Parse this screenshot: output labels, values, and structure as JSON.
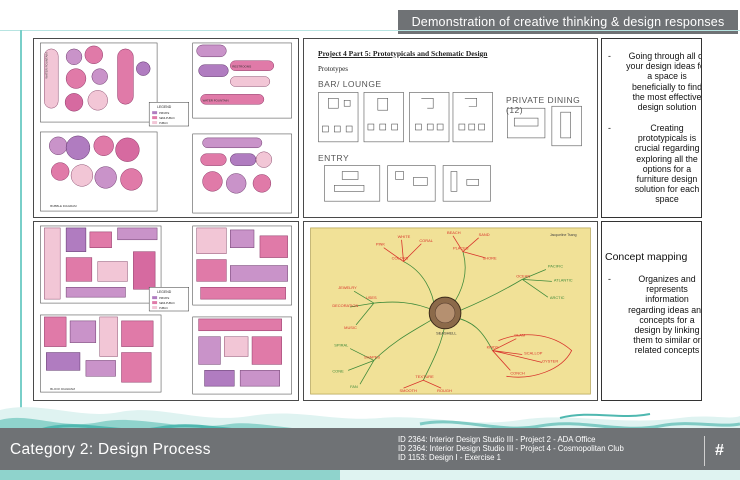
{
  "header": {
    "banner": "Demonstration of creative thinking & design responses"
  },
  "panels": {
    "bubble_top": {
      "bubbles": [
        {
          "label": "PRIVATE DINING"
        },
        {
          "label": "RESTROOMS"
        },
        {
          "label": "LOUNGE"
        },
        {
          "label": "BAR"
        },
        {
          "label": "ENTRY"
        },
        {
          "label": "GAMING"
        }
      ],
      "bubbles_right": [
        {
          "label": "ENTRY"
        },
        {
          "label": "LOUNGE"
        },
        {
          "label": "RESTROOMS"
        },
        {
          "label": "WATER FOUNTAIN"
        },
        {
          "label": "BAR"
        },
        {
          "label": "GAMING"
        }
      ],
      "legend": {
        "title": "LEGEND",
        "items": [
          "PRIVATE",
          "SEMI-PUBLIC",
          "PUBLIC"
        ]
      },
      "caption": "BUBBLE DIAGRAM",
      "caption_sub": "SCALE: NTS"
    },
    "bubble_bottom": {
      "legend": {
        "title": "LEGEND",
        "items": [
          "PRIVATE",
          "SEMI-PUBLIC",
          "PUBLIC"
        ]
      },
      "caption": "BLOCK DIAGRAM",
      "caption_sub": "SCALE: NTS",
      "labels": [
        "WATER FOUNTAIN",
        "ENTRY",
        "LOUNGE",
        "BAR",
        "GAMING",
        "RESTROOMS",
        "PRIVATE DINING",
        "WATER FOUNTAIN"
      ]
    },
    "prototypes": {
      "title": "Project 4 Part 5: Prototypicals and Schematic Design",
      "subtitle": "Prototypes",
      "bar_lounge": "BAR/ LOUNGE",
      "private_dining": "PRIVATE DINING (12)",
      "entry": "ENTRY"
    },
    "mindmap": {
      "center": "SEASHELL",
      "author": "Jacqueline Tsang",
      "words": [
        "USES",
        "SHAPES",
        "TEXTURE",
        "KINDS",
        "OCEAN",
        "COLORS",
        "PLACES",
        "BEACH",
        "JEWELRY",
        "DECORATION",
        "SHELTER",
        "MUSIC",
        "SPIRAL",
        "CONE",
        "FAN",
        "CLAM",
        "SCALLOP",
        "CONCH",
        "OYSTER",
        "MUSSEL",
        "PINK",
        "WHITE",
        "CORAL",
        "PEARL",
        "SMOOTH",
        "ROUGH",
        "SPIKY",
        "GRAINY",
        "SANDY",
        "PACIFIC",
        "ATLANTIC",
        "ARCTIC",
        "INDIAN",
        "HERMIT CRABS",
        "SNAIL",
        "COLLECT",
        "SOUVENIR"
      ]
    }
  },
  "text_top": {
    "bullets": [
      {
        "dash": "-",
        "text": "Going through all of your design ideas for a space is beneficially to find the most effective design solution"
      },
      {
        "dash": "-",
        "text": "Creating prototypicals is crucial regarding exploring all the options for a furniture design solution for each space"
      }
    ]
  },
  "text_bottom": {
    "title": "Concept mapping",
    "bullets": [
      {
        "dash": "-",
        "text": "Organizes and represents information regarding ideas and concepts for a design by linking them to similar or related concepts"
      }
    ]
  },
  "footer": {
    "title": "Category 2: Design Process",
    "courses": [
      "ID 2364: Interior Design Studio III - Project 2 - ADA Office",
      "ID 2364: Interior Design Studio III - Project 4 - Cosmopolitan Club",
      "ID 1153: Design I - Exercise 1"
    ],
    "page_marker": "#"
  },
  "colors": {
    "banner": "#6f7275",
    "teal_wave": "#4fb8b0",
    "private": "#b07cc0",
    "semi_public": "#e07aa8",
    "public": "#f2c6d6",
    "mindmap_board": "#f1e197",
    "mindmap_red": "#d8342c",
    "mindmap_green": "#3f8a3a"
  }
}
